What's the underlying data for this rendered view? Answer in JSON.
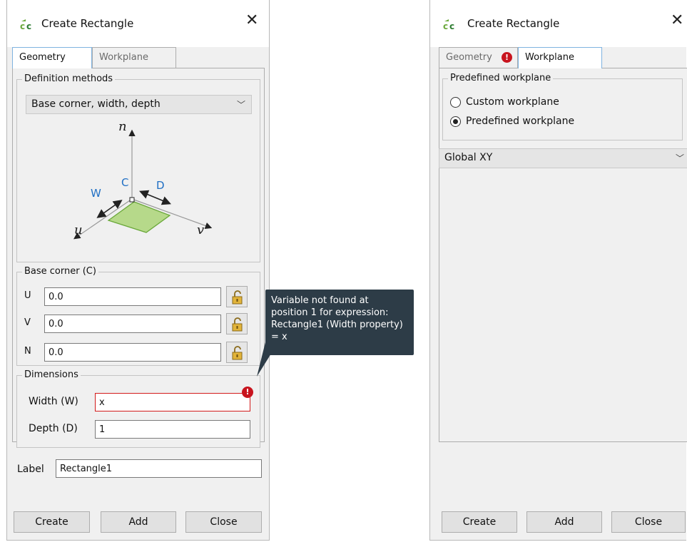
{
  "left_dialog": {
    "title": "Create Rectangle",
    "tabs": [
      {
        "label": "Geometry",
        "active": true
      },
      {
        "label": "Workplane",
        "active": false
      }
    ],
    "definition_methods": {
      "group_title": "Definition methods",
      "selected": "Base corner, width, depth"
    },
    "diagram": {
      "axis_n": "n",
      "axis_u": "u",
      "axis_v": "v",
      "label_w": "W",
      "label_c": "C",
      "label_d": "D"
    },
    "base_corner": {
      "group_title": "Base corner (C)",
      "fields": [
        {
          "label": "U",
          "value": "0.0"
        },
        {
          "label": "V",
          "value": "0.0"
        },
        {
          "label": "N",
          "value": "0.0"
        }
      ]
    },
    "dimensions": {
      "group_title": "Dimensions",
      "width_label": "Width (W)",
      "width_value": "x",
      "depth_label": "Depth (D)",
      "depth_value": "1"
    },
    "label": {
      "label": "Label",
      "value": "Rectangle1"
    },
    "buttons": {
      "create": "Create",
      "add": "Add",
      "close": "Close"
    }
  },
  "tooltip": {
    "text": "Variable not found at position 1 for expression: Rectangle1 (Width property) = x"
  },
  "right_dialog": {
    "title": "Create Rectangle",
    "tabs": [
      {
        "label": "Geometry",
        "active": false,
        "has_error": true
      },
      {
        "label": "Workplane",
        "active": true
      }
    ],
    "predefined_group": {
      "group_title": "Predefined workplane",
      "options": [
        {
          "label": "Custom workplane",
          "checked": false
        },
        {
          "label": "Predefined workplane",
          "checked": true
        }
      ]
    },
    "workplane_select": "Global XY",
    "buttons": {
      "create": "Create",
      "add": "Add",
      "close": "Close"
    }
  },
  "colors": {
    "error": "#c8141e",
    "accent_blue": "#1f6fc4",
    "shape_fill": "#b6d98a",
    "shape_stroke": "#6aa83a",
    "tooltip_bg": "#2d3c47",
    "lock_gold": "#e2b43a"
  }
}
